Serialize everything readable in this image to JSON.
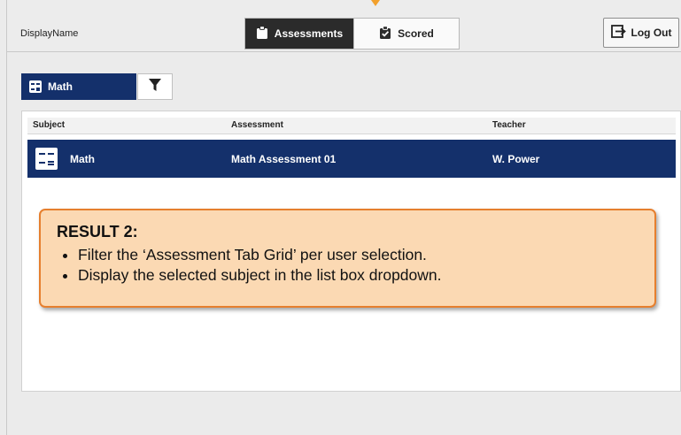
{
  "header": {
    "display_name": "DisplayName",
    "tabs": [
      {
        "label": "Assessments",
        "icon": "clipboard-icon",
        "active": true
      },
      {
        "label": "Scored",
        "icon": "clipboard-check-icon",
        "active": false
      }
    ],
    "logout_label": "Log Out"
  },
  "filter": {
    "selected_subject": "Math",
    "subject_icon": "math-symbols-icon",
    "filter_icon": "funnel-icon"
  },
  "grid": {
    "columns": [
      "Subject",
      "Assessment",
      "Teacher"
    ],
    "rows": [
      {
        "subject": "Math",
        "assessment": "Math Assessment 01",
        "teacher": "W. Power"
      }
    ]
  },
  "callout": {
    "title": "RESULT 2:",
    "bullets": [
      "Filter the ‘Assessment Tab Grid’ per user selection.",
      "Display the selected subject in the list box dropdown."
    ]
  },
  "colors": {
    "primary": "#14306b",
    "callout_bg": "#fbd9b3",
    "callout_border": "#e67f2e",
    "active_tab": "#2b2b2b"
  }
}
